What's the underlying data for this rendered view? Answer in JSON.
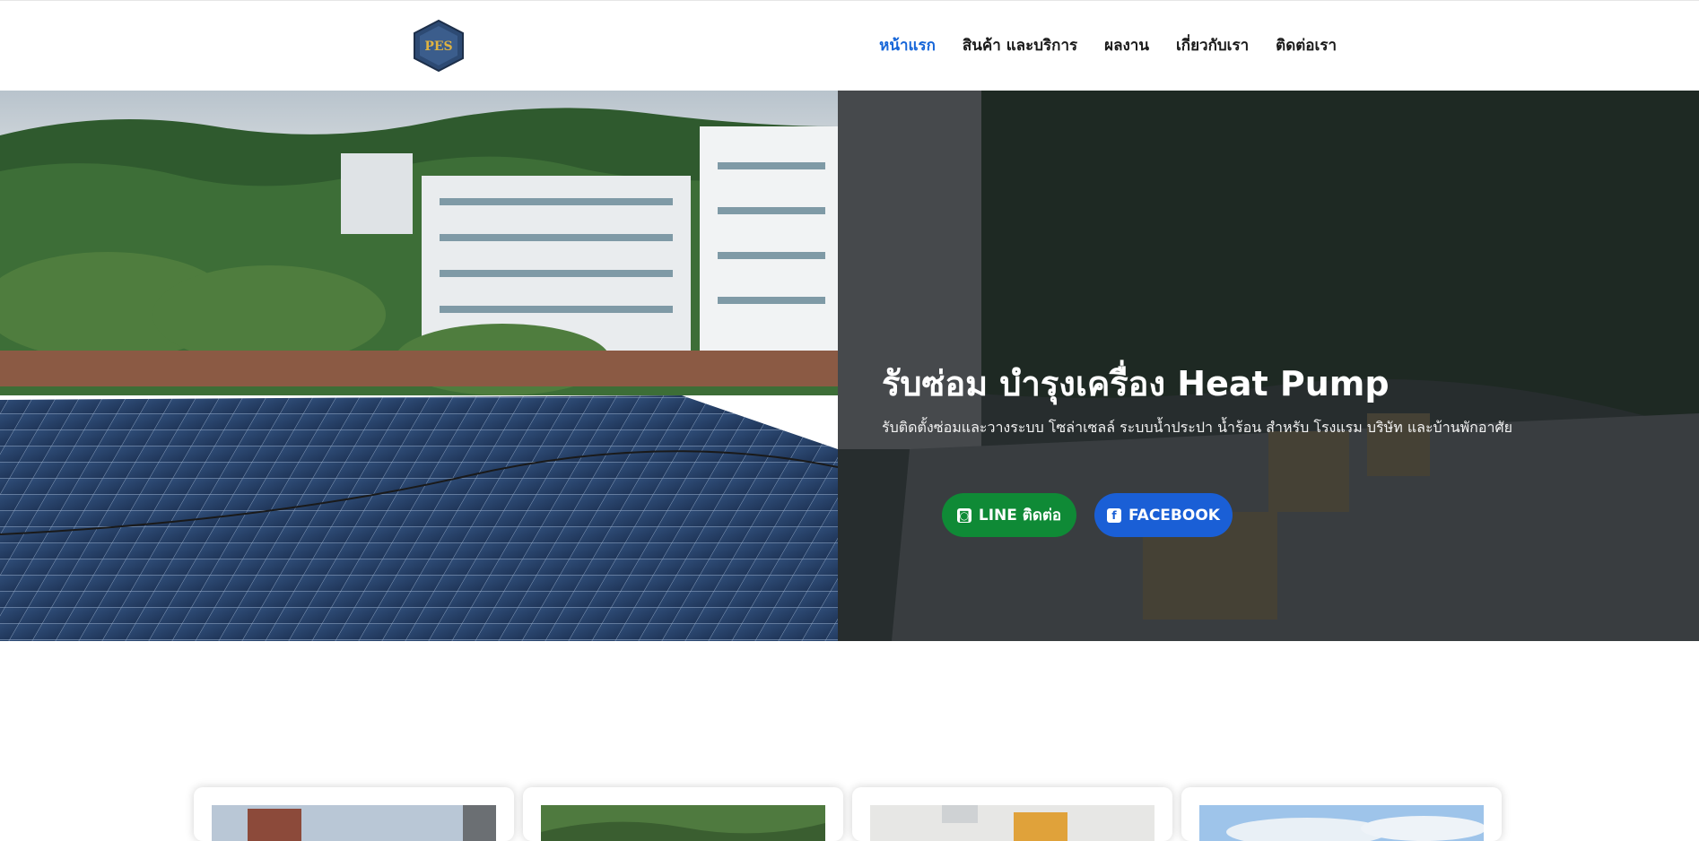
{
  "header": {
    "logo_text": "PES",
    "nav": [
      {
        "label": "หน้าแรก",
        "active": true
      },
      {
        "label": "สินค้า และบริการ",
        "active": false
      },
      {
        "label": "ผลงาน",
        "active": false
      },
      {
        "label": "เกี่ยวกับเรา",
        "active": false
      },
      {
        "label": "ติดต่อเรา",
        "active": false
      }
    ]
  },
  "hero": {
    "title": "รับซ่อม บำรุงเครื่อง Heat Pump",
    "subtitle": "รับติดตั้งซ่อมและวางระบบ โซล่าเซลล์ ระบบน้ำประปา น้ำร้อน สำหรับ โรงแรม บริษัท และบ้านพักอาศัย",
    "buttons": [
      {
        "label": "LINE ติดต่อ",
        "icon": "line-icon",
        "color": "#0f8a36"
      },
      {
        "label": "FACEBOOK",
        "icon": "facebook-icon",
        "color": "#1a5fd6"
      }
    ]
  },
  "colors": {
    "accent": "#1565d8",
    "line_green": "#0f8a36",
    "facebook_blue": "#1a5fd6"
  }
}
